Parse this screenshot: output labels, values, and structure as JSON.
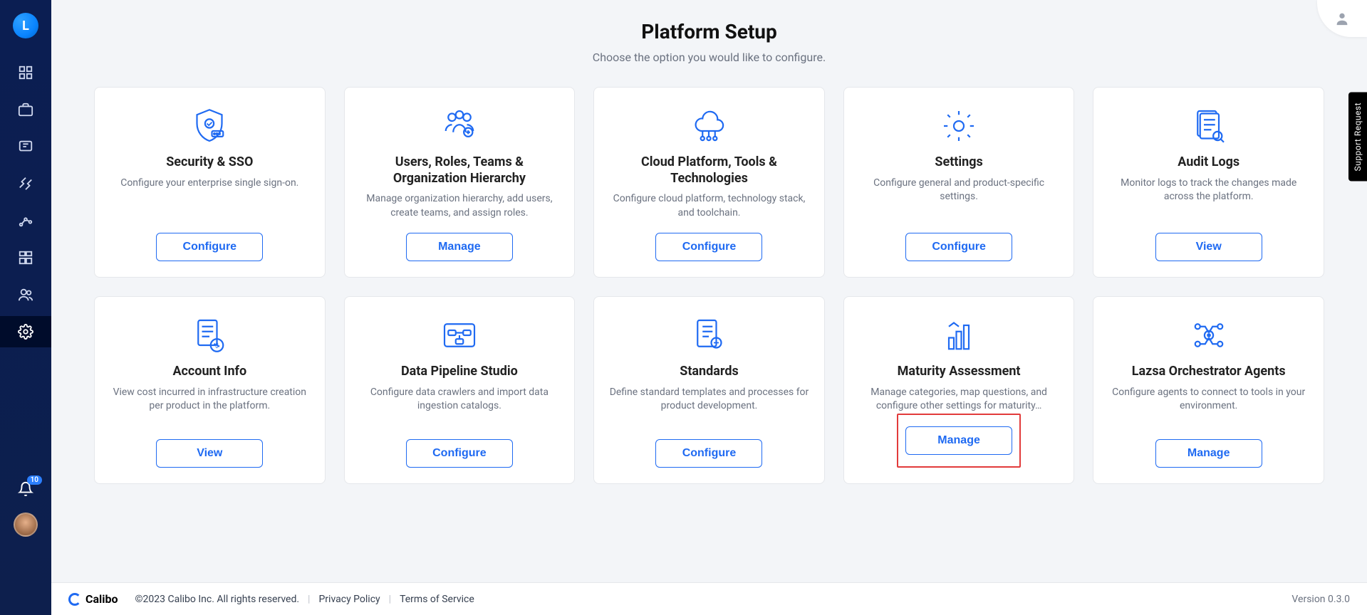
{
  "logo_letter": "L",
  "notif_count": "10",
  "support_tab": "Support Request",
  "header": {
    "title": "Platform Setup",
    "subtitle": "Choose the option you would like to configure."
  },
  "cards": [
    {
      "title": "Security & SSO",
      "desc": "Configure your enterprise single sign-on.",
      "action": "Configure"
    },
    {
      "title": "Users, Roles, Teams & Organization Hierarchy",
      "desc": "Manage organization hierarchy, add users, create teams, and assign roles.",
      "action": "Manage"
    },
    {
      "title": "Cloud Platform, Tools & Technologies",
      "desc": "Configure cloud platform, technology stack, and toolchain.",
      "action": "Configure"
    },
    {
      "title": "Settings",
      "desc": "Configure general and product-specific settings.",
      "action": "Configure"
    },
    {
      "title": "Audit Logs",
      "desc": "Monitor logs to track the changes made across the platform.",
      "action": "View"
    },
    {
      "title": "Account Info",
      "desc": "View cost incurred in infrastructure creation per product in the platform.",
      "action": "View"
    },
    {
      "title": "Data Pipeline Studio",
      "desc": "Configure data crawlers and import data ingestion catalogs.",
      "action": "Configure"
    },
    {
      "title": "Standards",
      "desc": "Define standard templates and processes for product development.",
      "action": "Configure"
    },
    {
      "title": "Maturity Assessment",
      "desc": "Manage categories, map questions, and configure other settings for maturity…",
      "action": "Manage",
      "highlighted": true
    },
    {
      "title": "Lazsa Orchestrator Agents",
      "desc": "Configure agents to connect to tools in your environment.",
      "action": "Manage"
    }
  ],
  "footer": {
    "brand": "Calibo",
    "copyright": "©2023 Calibo Inc. All rights reserved.",
    "privacy": "Privacy Policy",
    "terms": "Terms of Service",
    "version": "Version 0.3.0"
  }
}
